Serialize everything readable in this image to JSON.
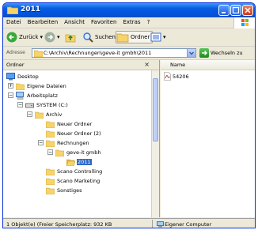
{
  "window": {
    "title": "2011",
    "title_icon": "folder-icon",
    "buttons": [
      "minimize-icon",
      "maximize-icon",
      "close-icon"
    ]
  },
  "menu": [
    "Datei",
    "Bearbeiten",
    "Ansicht",
    "Favoriten",
    "Extras",
    "?"
  ],
  "toolbar": {
    "back_label": "Zurück",
    "search_label": "Suchen",
    "folders_label": "Ordner"
  },
  "address": {
    "label": "Adresse",
    "value": "C:\\Archiv\\Rechnungen\\geve-it gmbh\\2011",
    "go_label": "Wechseln zu"
  },
  "folder_pane": {
    "title": "Ordner",
    "close": "×",
    "tree": [
      {
        "label": "Desktop",
        "icon": "desktop-icon"
      },
      {
        "label": "Eigene Dateien",
        "icon": "folder-icon",
        "expander": "+"
      },
      {
        "label": "Arbeitsplatz",
        "icon": "computer-icon",
        "expander": "−"
      },
      {
        "label": "SYSTEM (C:)",
        "icon": "drive-icon",
        "expander": "−"
      },
      {
        "label": "Archiv",
        "icon": "folder-icon",
        "expander": "−"
      },
      {
        "label": "Neuer Ordner",
        "icon": "folder-icon"
      },
      {
        "label": "Neuer Ordner (2)",
        "icon": "folder-icon"
      },
      {
        "label": "Rechnungen",
        "icon": "folder-icon",
        "expander": "−"
      },
      {
        "label": "geve-it gmbh",
        "icon": "folder-icon",
        "expander": "−"
      },
      {
        "label": "2011",
        "icon": "folder-open-icon",
        "selected": true
      },
      {
        "label": "Scano Controlling",
        "icon": "folder-icon"
      },
      {
        "label": "Scano Marketing",
        "icon": "folder-icon"
      },
      {
        "label": "Sonstiges",
        "icon": "folder-icon"
      }
    ]
  },
  "content": {
    "column_name": "Name",
    "files": [
      {
        "label": "54206",
        "icon": "pdf-icon"
      }
    ]
  },
  "status": {
    "left": "1 Objekt(e) (Freier Speicherplatz: 932 KB",
    "right": "Eigener Computer",
    "right_icon": "computer-icon"
  },
  "colors": {
    "title_bar": "#0055e5",
    "selection": "#316ac5",
    "window_bg": "#ece9d8",
    "folder": "#f5c94a"
  }
}
